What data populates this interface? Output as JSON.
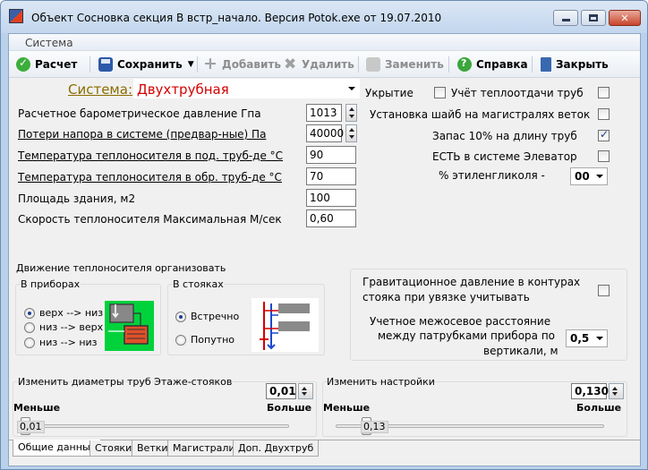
{
  "window": {
    "title": "Объект Сосновка секция В встр_начало. Версия Potok.exe от 19.07.2010"
  },
  "menu": {
    "items": [
      "Система"
    ]
  },
  "toolbar": {
    "calc": "Расчет",
    "save": "Сохранить",
    "add": "Добавить",
    "delete": "Удалить",
    "replace": "Заменить",
    "help": "Справка",
    "close": "Закрыть"
  },
  "form": {
    "system_label": "Система:",
    "system_value": "Двухтрубная",
    "rows": [
      {
        "label": "Расчетное барометрическое давление  Гпа",
        "value": "1013"
      },
      {
        "label": "Потери напора в системе (предвар-ные)  Па",
        "value": "40000"
      },
      {
        "label": "Температура теплоносителя в под. труб-де  °С",
        "value": "90"
      },
      {
        "label": "Температура теплоносителя в обр. труб-де °С",
        "value": "70"
      },
      {
        "label": "Площадь здания, м2",
        "value": "100"
      },
      {
        "label": "Скорость теплоносителя Максимальная М/сек",
        "value": "0,60"
      }
    ],
    "right": {
      "ukrytie": "Укрытие",
      "heat_loss": "Учёт теплоотдачи труб",
      "washers": "Установка шайб на магистралях веток",
      "reserve": "Запас 10% на длину труб",
      "elevator": "ЕСТЬ в системе Элеватор",
      "glycol_label": "% этиленгликоля  -",
      "glycol_value": "00",
      "heat_loss_checked": false,
      "washers_checked": false,
      "reserve_checked": true,
      "elevator_checked": false,
      "ukrytie_checked": false
    }
  },
  "movement": {
    "title": "Движение теплоносителя организовать",
    "devices_title": "В приборах",
    "devices_options": [
      "верх --> низ",
      "низ --> верх",
      "низ --> низ"
    ],
    "devices_selected": 0,
    "risers_title": "В стояках",
    "risers_options": [
      "Встречно",
      "Попутно"
    ],
    "risers_selected": 0
  },
  "gravity": {
    "label_line1": "Гравитационное давление в контурах",
    "label_line2": "стояка при увязке учитывать",
    "checked": false,
    "spacing_line1": "Учетное межосевое расстояние",
    "spacing_line2": "между патрубками прибора по",
    "spacing_line3": "вертикали, м",
    "spacing_value": "0,5"
  },
  "slider_left": {
    "title": "Изменить диаметры труб Этаже-стояков",
    "value": "0,01",
    "less": "Меньше",
    "more": "Больше",
    "thumb_label": "0,01",
    "fraction": 0.0
  },
  "slider_right": {
    "title": "Изменить настройки",
    "value": "0,130",
    "less": "Меньше",
    "more": "Больше",
    "thumb_label": "0,13",
    "fraction": 0.1
  },
  "tabs": [
    "Общие данные",
    "Стояки",
    "Ветки",
    "Магистрали",
    "Доп. Двухтруб"
  ],
  "active_tab": 0,
  "colors": {
    "system_value": "#d40000",
    "system_label": "#8a6d00",
    "green_panel": "#00d23c"
  }
}
